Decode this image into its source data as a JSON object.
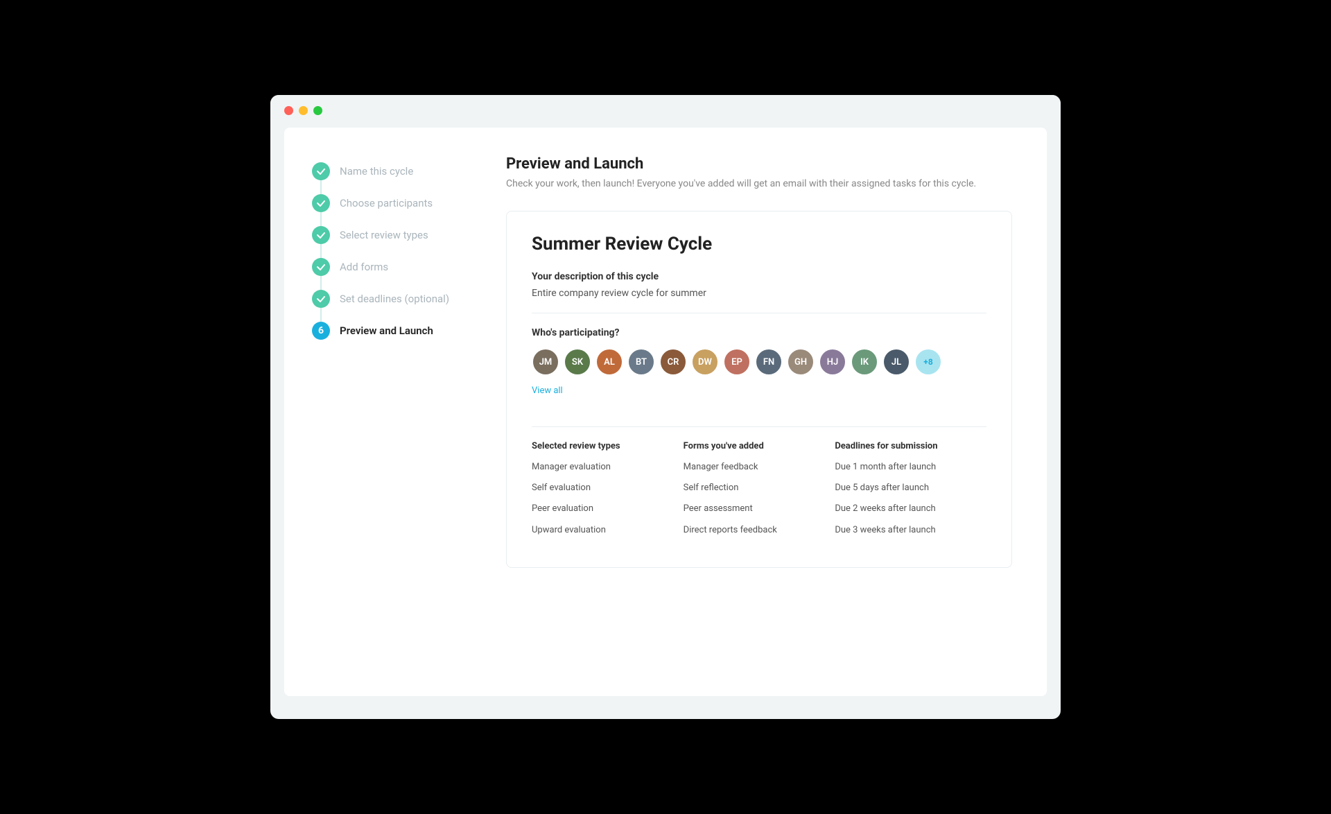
{
  "window": {
    "background": "#f0f4f5"
  },
  "sidebar": {
    "steps": [
      {
        "id": 1,
        "label": "Name this cycle",
        "state": "completed"
      },
      {
        "id": 2,
        "label": "Choose participants",
        "state": "completed"
      },
      {
        "id": 3,
        "label": "Select review types",
        "state": "completed"
      },
      {
        "id": 4,
        "label": "Add forms",
        "state": "completed"
      },
      {
        "id": 5,
        "label": "Set deadlines (optional)",
        "state": "completed"
      },
      {
        "id": 6,
        "label": "Preview and Launch",
        "state": "active"
      }
    ]
  },
  "main": {
    "title": "Preview and Launch",
    "subtitle": "Check your work, then launch! Everyone you've added will get an email with their assigned tasks for this cycle.",
    "card": {
      "cycle_title": "Summer Review Cycle",
      "description_label": "Your description of this cycle",
      "description_text": "Entire company review cycle for summer",
      "participants_label": "Who's participating?",
      "avatars": [
        {
          "initials": "JM",
          "color": "av1"
        },
        {
          "initials": "SK",
          "color": "av2"
        },
        {
          "initials": "AL",
          "color": "av3"
        },
        {
          "initials": "BT",
          "color": "av4"
        },
        {
          "initials": "CR",
          "color": "av5"
        },
        {
          "initials": "DW",
          "color": "av6"
        },
        {
          "initials": "EP",
          "color": "av7"
        },
        {
          "initials": "FN",
          "color": "av8"
        },
        {
          "initials": "GH",
          "color": "av9"
        },
        {
          "initials": "HJ",
          "color": "av10"
        },
        {
          "initials": "IK",
          "color": "av11"
        },
        {
          "initials": "JL",
          "color": "av12"
        }
      ],
      "avatar_more": "+8",
      "view_all_label": "View all",
      "columns": {
        "review_types": {
          "header": "Selected review types",
          "items": [
            "Manager evaluation",
            "Self evaluation",
            "Peer evaluation",
            "Upward evaluation"
          ]
        },
        "forms": {
          "header": "Forms you've added",
          "items": [
            "Manager feedback",
            "Self reflection",
            "Peer assessment",
            "Direct reports feedback"
          ]
        },
        "deadlines": {
          "header": "Deadlines for submission",
          "items": [
            "Due 1 month after launch",
            "Due 5 days after launch",
            "Due 2 weeks after launch",
            "Due 3 weeks after launch"
          ]
        }
      }
    }
  }
}
